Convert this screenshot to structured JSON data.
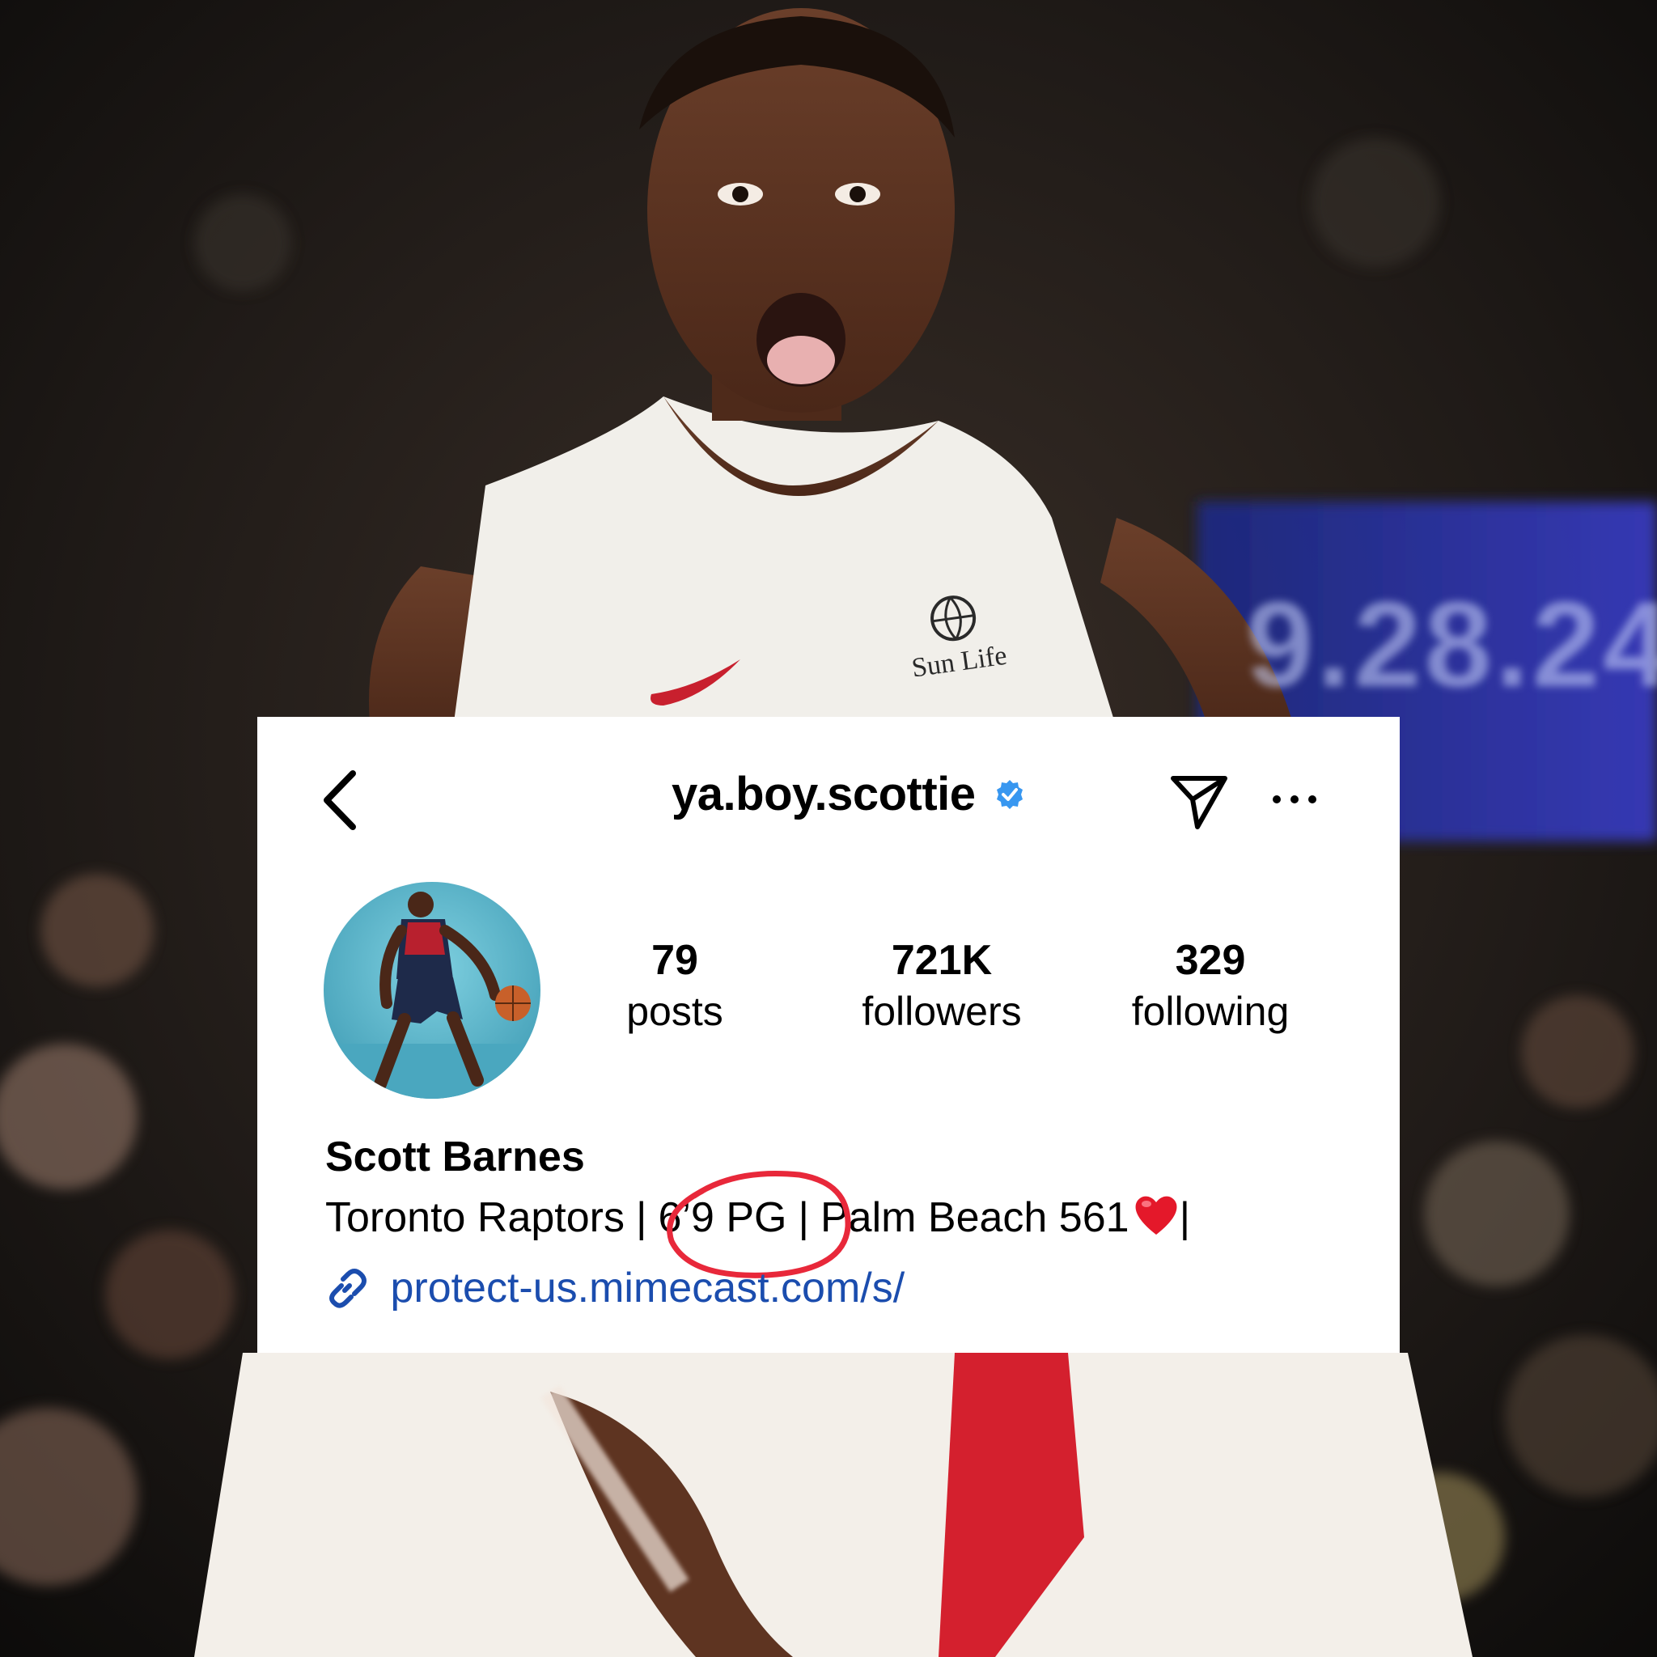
{
  "profile": {
    "username": "ya.boy.scottie",
    "verified": true,
    "display_name": "Scott Barnes",
    "bio": {
      "team": "Toronto Raptors",
      "separator": "|",
      "height_position": "6’9 PG",
      "hometown": "Palm Beach 561",
      "trailing": "|"
    },
    "link": "protect-us.mimecast.com/s/"
  },
  "stats": {
    "posts": {
      "count": "79",
      "label": "posts"
    },
    "followers": {
      "count": "721K",
      "label": "followers"
    },
    "following": {
      "count": "329",
      "label": "following"
    }
  },
  "background": {
    "jersey_sponsor": "Sun Life",
    "arena_board_text": "9.28.24"
  },
  "icons": {
    "back": "chevron-left-icon",
    "verified": "verified-badge-icon",
    "send": "paper-plane-icon",
    "more": "ellipsis-icon",
    "link": "link-chain-icon",
    "heart": "red-heart-emoji"
  },
  "colors": {
    "verified_blue": "#3897f0",
    "link_blue": "#1b4dae",
    "annotation_red": "#e8283a",
    "card_background": "#ffffff"
  }
}
